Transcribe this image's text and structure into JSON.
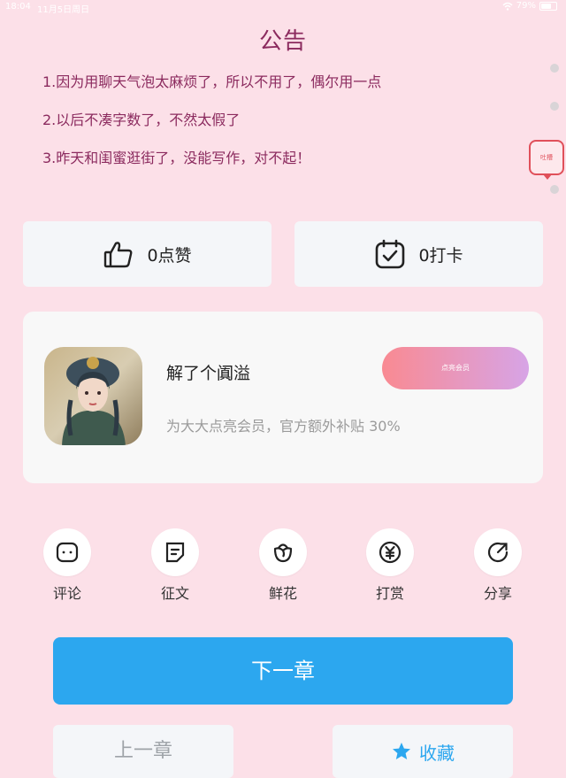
{
  "status_bar": {
    "time": "18:04",
    "date": "11月5日周日",
    "battery": "79%",
    "battery_level": 0.79
  },
  "announcement": {
    "title": "公告",
    "lines": [
      "1.因为用聊天气泡太麻烦了，所以不用了，偶尔用一点",
      "2.以后不凑字数了，不然太假了",
      "3.昨天和闺蜜逛街了，没能写作，对不起！"
    ]
  },
  "side_panel": {
    "tag_label": "吐槽"
  },
  "stats": {
    "like": {
      "label": "0点赞",
      "icon": "thumbs-up-icon"
    },
    "checkin": {
      "label": "0打卡",
      "icon": "calendar-check-icon"
    }
  },
  "member_card": {
    "name": "解了个阗溢",
    "description": "为大大点亮会员，官方额外补贴 30%",
    "button_label": "点亮会员",
    "gradient": [
      "#f98a92",
      "#d7a4e6"
    ]
  },
  "actions": [
    {
      "label": "评论",
      "icon": "comment-icon"
    },
    {
      "label": "征文",
      "icon": "document-icon"
    },
    {
      "label": "鲜花",
      "icon": "flower-icon"
    },
    {
      "label": "打赏",
      "icon": "yen-icon"
    },
    {
      "label": "分享",
      "icon": "share-icon"
    }
  ],
  "navigation": {
    "next_label": "下一章",
    "prev_label": "上一章",
    "favorite_label": "收藏"
  },
  "colors": {
    "background": "#fce0e8",
    "title": "#8b2a5e",
    "primary": "#2ca7ef"
  }
}
